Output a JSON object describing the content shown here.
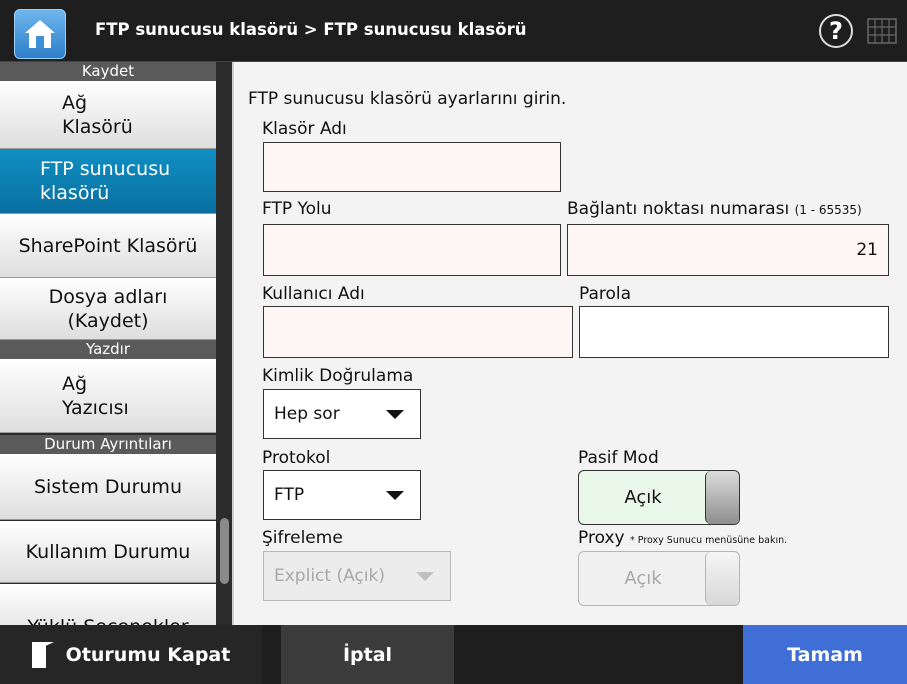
{
  "header": {
    "title": "FTP sunucusu klasörü > FTP sunucusu klasörü",
    "help_label": "?"
  },
  "sidebar": {
    "sections": [
      {
        "label": "Kaydet"
      },
      {
        "label": "Yazdır"
      },
      {
        "label": "Durum Ayrıntıları"
      }
    ],
    "items": [
      {
        "label": "Ağ\nKlasörü"
      },
      {
        "label": "FTP sunucusu\nklasörü"
      },
      {
        "label": "SharePoint Klasörü"
      },
      {
        "label": "Dosya adları\n(Kaydet)"
      },
      {
        "label": "Ağ\nYazıcısı"
      },
      {
        "label": "Sistem Durumu"
      },
      {
        "label": "Kullanım Durumu"
      },
      {
        "label": "Yüklü Seçenekler"
      }
    ]
  },
  "main": {
    "instruction": "FTP sunucusu klasörü ayarlarını girin.",
    "folder_name": {
      "label": "Klasör Adı",
      "value": ""
    },
    "ftp_path": {
      "label": "FTP Yolu",
      "value": ""
    },
    "port": {
      "label": "Bağlantı noktası numarası",
      "range": "(1 - 65535)",
      "value": "21"
    },
    "username": {
      "label": "Kullanıcı Adı",
      "value": ""
    },
    "password": {
      "label": "Parola",
      "value": ""
    },
    "authentication": {
      "label": "Kimlik Doğrulama",
      "selected": "Hep sor"
    },
    "protocol": {
      "label": "Protokol",
      "selected": "FTP"
    },
    "passive_mode": {
      "label": "Pasif Mod",
      "state": "Açık"
    },
    "encryption": {
      "label": "Şifreleme",
      "selected": "Explict (Açık)"
    },
    "proxy": {
      "label": "Proxy",
      "note": "* Proxy Sunucu menüsüne bakın.",
      "state": "Açık"
    }
  },
  "footer": {
    "logout_label": "Oturumu Kapat",
    "cancel_label": "İptal",
    "ok_label": "Tamam"
  },
  "colors": {
    "active_nav": "#0a7fb5",
    "ok_button": "#3e6ed6",
    "toggle_on": "#e9f8e9"
  }
}
